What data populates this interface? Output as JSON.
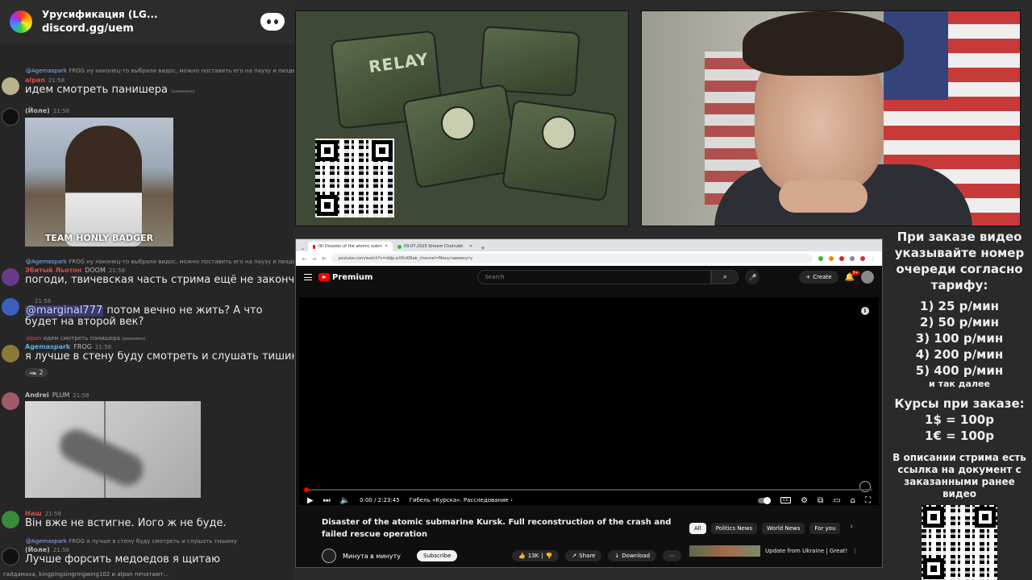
{
  "server": {
    "name": "Урусификация (LG...",
    "link": "discord.gg/uem"
  },
  "messages": [
    {
      "reply_author": "@Agemaspark",
      "reply_badge": "FROG",
      "reply_text": "ну наконец-то выбрали видос, можно поставить его на паузу и пиздеть"
    },
    {
      "author": "alpan",
      "time": "21:58",
      "text": "идем смотреть панишера",
      "suffix": "(изменено)"
    },
    {
      "author": "(Йоле)",
      "time": "21:58",
      "gif_caption": "TEAM HONLY BADGER"
    },
    {
      "reply_author": "@Agemaspark",
      "reply_badge": "FROG",
      "reply_text": "ну наконец-то выбрали видос, можно поставить его на паузу и пиздеть",
      "author": "Эбитый Льотон",
      "badge": "DOOM",
      "time": "21:58",
      "text": "погоди, твичевская часть стрима ещё не закончилась"
    },
    {
      "time": "21:58",
      "mention": "@marginal777",
      "text": "потом вечно не жить? А что будет на второй век?"
    },
    {
      "reply_author": "alpan",
      "reply_text": "идем смотреть панишера",
      "reply_suffix": "(изменено)",
      "author": "Agemaspark",
      "badge": "FROG",
      "time": "21:58",
      "text": "я лучше в стену буду смотреть и слушать тишину",
      "reaction": "2"
    },
    {
      "author": "Andrei",
      "badge": "PLUM",
      "time": "21:58"
    },
    {
      "author": "Наш",
      "time": "21:58",
      "text": "Він вже не встигне. Иого ж не буде."
    },
    {
      "reply_author": "@Agemaspark",
      "reply_badge": "FROG",
      "reply_text": "я лучше в стену буду смотреть и слушать тишину",
      "author": "(Йоле)",
      "time": "21:58",
      "text": "Лучше форсить медоедов я щитаю"
    }
  ],
  "typing": "гайдамаха, kingpingsingringwing102 и alpan печатают...",
  "relay": {
    "label": "RELAY"
  },
  "browser": {
    "tab_active": "(9) Disaster of the atomic subm",
    "tab_inactive": "09.07.2025 Stream Chatrulet",
    "url": "youtube.com/watch?v=ddjp-pXKsI08ab_channel=Минутавминуту",
    "yt_logo": "Premium",
    "search_placeholder": "Search",
    "create": "Create",
    "notif_count": "9+",
    "time": "0:00 / 2:23:45",
    "chapter": "Гибель «Курска». Расследование",
    "title": "Disaster of the atomic submarine Kursk. Full reconstruction of the crash and failed rescue operation",
    "channel": "Минута в минуту",
    "subscribe": "Subscribe",
    "likes": "13K",
    "share": "Share",
    "download": "Download",
    "chips": [
      "All",
      "Politics News",
      "World News",
      "For you"
    ],
    "rec_title": "Update from Ukraine | Great!"
  },
  "info": {
    "head": "При заказе видео указывайте номер очереди согласно тарифу:",
    "prices": [
      "1) 25 р/мин",
      "2) 50 р/мин",
      "3) 100 р/мин",
      "4) 200 р/мин",
      "5) 400 р/мин"
    ],
    "etc": "и так далее",
    "rates_head": "Курсы при заказе:",
    "rates": [
      "1$ = 100р",
      "1€ = 100р"
    ],
    "doc_note": "В описании стрима есть ссылка на документ с заказанными ранее видео"
  }
}
